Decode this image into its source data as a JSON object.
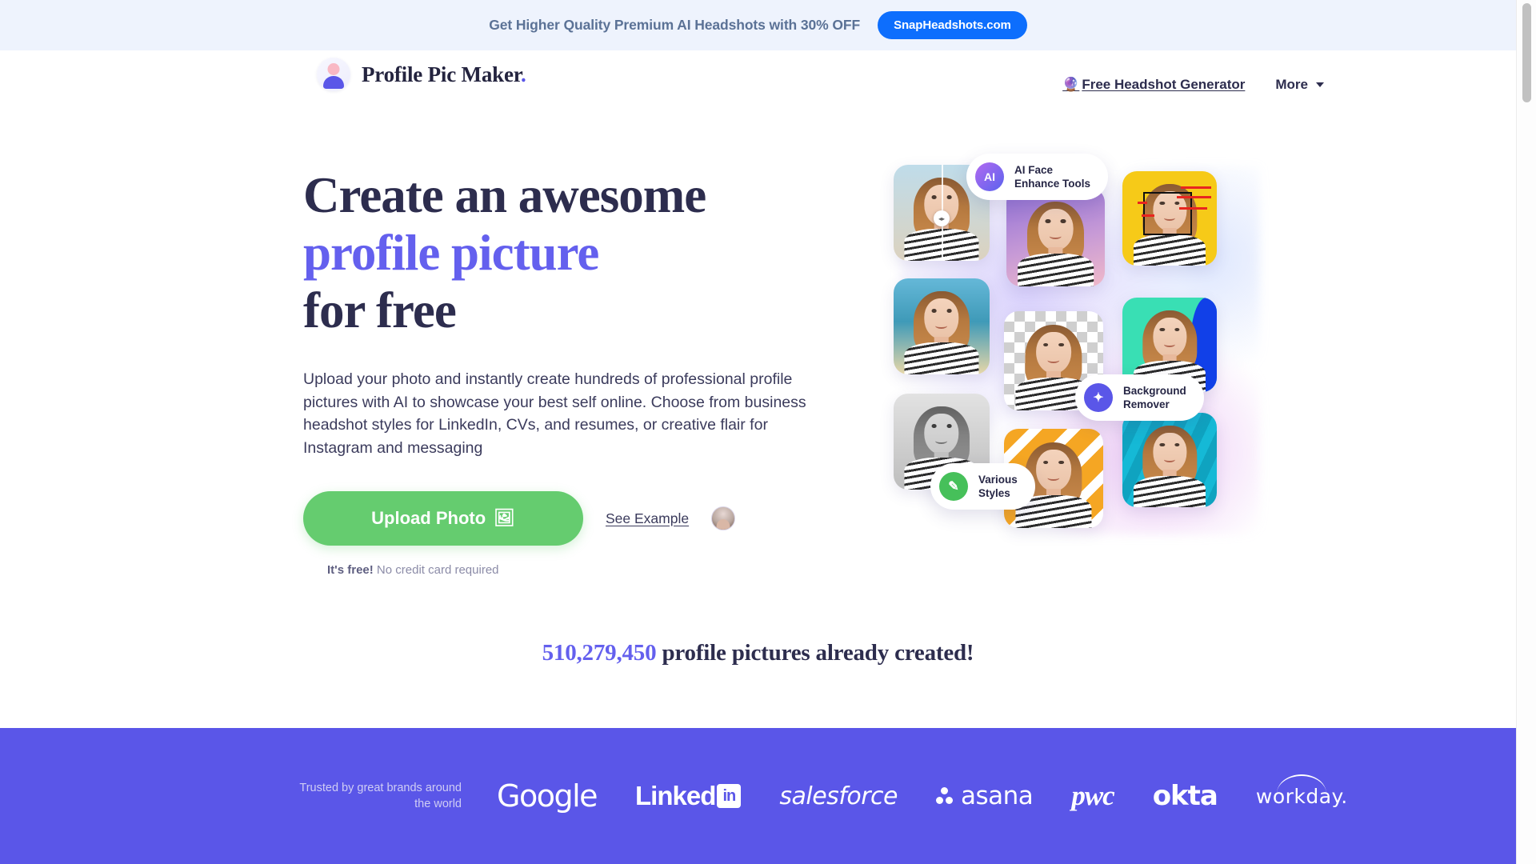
{
  "promo": {
    "text": "Get Higher Quality Premium AI Headshots with 30% OFF",
    "button_label": "SnapHeadshots.com",
    "button_color": "#0d6efd",
    "bg_color": "#eef3fd"
  },
  "header": {
    "logo_text": "Profile Pic Maker",
    "logo_dot": ".",
    "logo_icon": "avatar-icon",
    "nav": {
      "free_generator_emoji": "🔮",
      "free_generator": "Free Headshot Generator",
      "more": "More",
      "more_caret_icon": "chevron-down-icon"
    }
  },
  "hero": {
    "title_line1": "Create an awesome",
    "title_accent": "profile picture",
    "title_line3": "for free",
    "accent_color": "#6460ee",
    "subtitle": "Upload your photo and instantly create hundreds of professional profile pictures with AI to showcase your best self online. Choose from business headshot styles for LinkedIn, CVs, and resumes, or creative flair for Instagram and messaging",
    "upload_label": "Upload Photo",
    "upload_icon": "image-icon",
    "upload_color": "#65cc6f",
    "see_example": "See Example",
    "free_note_bold": "It's free!",
    "free_note_rest": " No credit card required"
  },
  "collage": {
    "pills": [
      {
        "icon": "ai-badge-icon",
        "icon_text": "AI",
        "label": "AI Face\nEnhance Tools"
      },
      {
        "icon": "magic-wand-icon",
        "icon_text": "✦",
        "label": "Background\nRemover"
      },
      {
        "icon": "paint-brush-icon",
        "icon_text": "✎",
        "label": "Various\nStyles"
      }
    ],
    "cards": [
      {
        "name": "before-after-card",
        "style": "beach-sky"
      },
      {
        "name": "purple-gradient-card",
        "style": "purple"
      },
      {
        "name": "face-detection-card",
        "style": "yellow"
      },
      {
        "name": "tropical-card",
        "style": "tropic"
      },
      {
        "name": "transparent-bg-card",
        "style": "checkerboard"
      },
      {
        "name": "mint-blue-card",
        "style": "mint"
      },
      {
        "name": "grayscale-card",
        "style": "gray"
      },
      {
        "name": "orange-pattern-card",
        "style": "orange"
      },
      {
        "name": "cyan-stripes-card",
        "style": "cyan"
      }
    ]
  },
  "counter": {
    "number": "510,279,450",
    "suffix": " profile pictures already created!"
  },
  "brands": {
    "bg_color": "#5a56e8",
    "trusted_line1": "Trusted by great brands around",
    "trusted_line2": "the world",
    "logos": [
      {
        "name": "google",
        "label": "Google"
      },
      {
        "name": "linkedin",
        "label": "Linked",
        "badge": "in"
      },
      {
        "name": "salesforce",
        "label": "salesforce"
      },
      {
        "name": "asana",
        "label": "asana"
      },
      {
        "name": "pwc",
        "label": "pwc"
      },
      {
        "name": "okta",
        "label": "okta"
      },
      {
        "name": "workday",
        "label": "workday."
      }
    ]
  }
}
